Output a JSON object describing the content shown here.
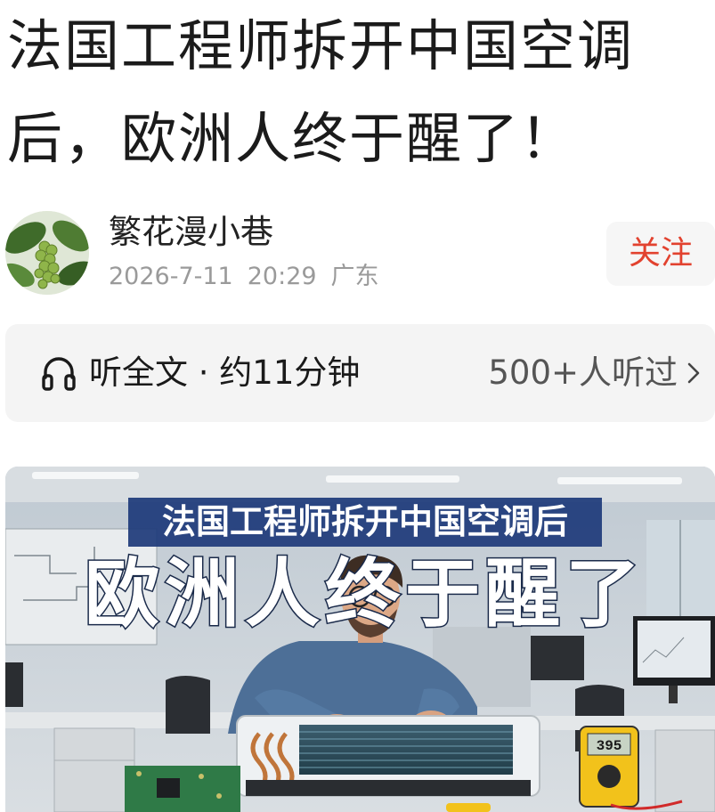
{
  "article": {
    "title": "法国工程师拆开中国空调后，欧洲人终于醒了！"
  },
  "author": {
    "name": "繁花漫小巷",
    "date": "2026-7-11",
    "time": "20:29",
    "location": "广东",
    "follow_label": "关注",
    "avatar_icon": "coffee-plant-avatar"
  },
  "listen": {
    "label": "听全文 · 约11分钟",
    "count": "500+人听过",
    "icon": "headphones-icon"
  },
  "hero_image": {
    "caption_line1": "法国工程师拆开中国空调后",
    "caption_line2": "欧洲人终于醒了",
    "meter_reading": "395"
  },
  "colors": {
    "follow": "#e2422f",
    "meta": "#9a9a9a",
    "listen_bg": "#f4f4f4"
  }
}
